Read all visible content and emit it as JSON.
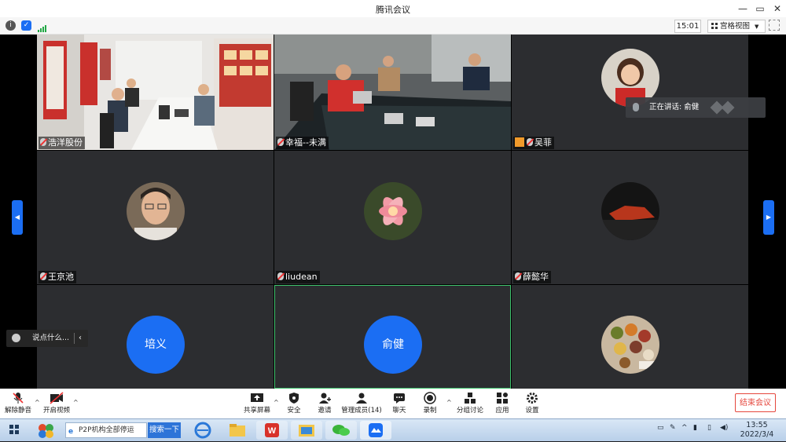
{
  "window": {
    "title": "腾讯会议"
  },
  "infobar": {
    "time": "15:01",
    "view_label": "宫格视图"
  },
  "tiles": [
    {
      "name": "浩洋股份"
    },
    {
      "name": "幸福--未满"
    },
    {
      "name": "吴菲"
    },
    {
      "name": "王京池"
    },
    {
      "name": "liudean"
    },
    {
      "name": "薛懿华"
    },
    {
      "name": "培义"
    },
    {
      "name": "俞健"
    },
    {
      "name": ""
    }
  ],
  "speaking": {
    "label": "正在讲话: 俞健"
  },
  "chat": {
    "placeholder": "说点什么..."
  },
  "toolbar": {
    "unmute": "解除静音",
    "start_video": "开启视频",
    "share": "共享屏幕",
    "security": "安全",
    "invite": "邀请",
    "manage": "管理成员(14)",
    "chat": "聊天",
    "record": "录制",
    "breakout": "分组讨论",
    "apps": "应用",
    "settings": "设置",
    "end": "结束会议"
  },
  "taskbar": {
    "search_text": "P2P机构全部停运",
    "search_button": "搜索一下",
    "time": "13:55",
    "date": "2022/3/4"
  },
  "colors": {
    "accent": "#1b6ef3",
    "danger": "#e5473d",
    "active_border": "#3ec46d"
  }
}
